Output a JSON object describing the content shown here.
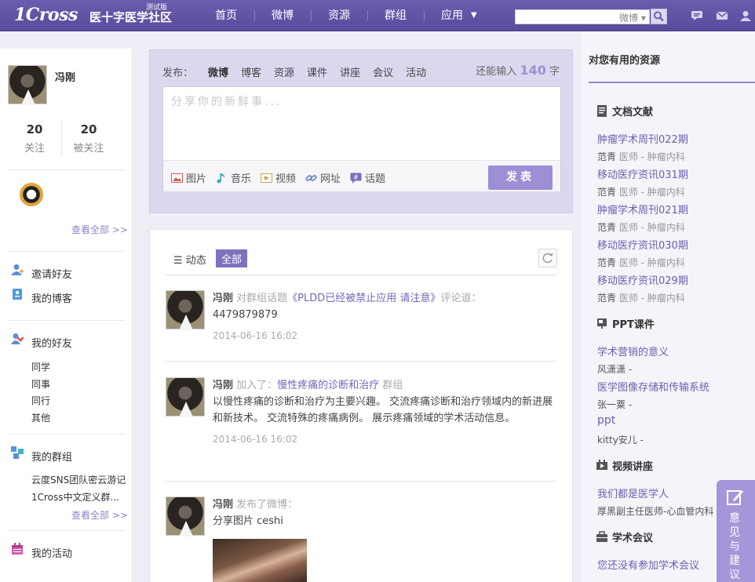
{
  "header": {
    "logo": "1Cross",
    "logo_cn": "医十字医学社区",
    "beta": "测试版",
    "nav": [
      "首页",
      "微博",
      "资源",
      "群组",
      "应用"
    ],
    "search_scope": "微博",
    "search_value": ""
  },
  "profile": {
    "name": "冯刚",
    "following_count": "20",
    "following_label": "关注",
    "followers_count": "20",
    "followers_label": "被关注",
    "view_all": "查看全部 >>"
  },
  "sidebar": {
    "invite": "邀请好友",
    "blog": "我的博客",
    "friends": "我的好友",
    "friend_groups": [
      "同学",
      "同事",
      "同行",
      "其他"
    ],
    "groups": "我的群组",
    "group_items": [
      "云度SNS团队密云游记",
      "1Cross中文定义群..."
    ],
    "groups_view_all": "查看全部 >>",
    "activities": "我的活动"
  },
  "post": {
    "label": "发布：",
    "categories": [
      "微博",
      "博客",
      "资源",
      "课件",
      "讲座",
      "会议",
      "活动"
    ],
    "count_prefix": "还能输入",
    "count": "140",
    "count_suffix": "字",
    "placeholder": "分享你的新鲜事...",
    "tools": [
      "图片",
      "音乐",
      "视频",
      "网址",
      "话题"
    ],
    "submit": "发表"
  },
  "feed": {
    "tab_label": "动态",
    "tab_all": "全部",
    "items": [
      {
        "name": "冯刚",
        "action": "对群组话题",
        "link": "《PLDD已经被禁止应用 请注意》",
        "action2": "评论道：",
        "text": "4479879879",
        "time": "2014-06-16 16:02"
      },
      {
        "name": "冯刚",
        "action": "加入了：",
        "link": "慢性疼痛的诊断和治疗",
        "action2": "群组",
        "text": "以慢性疼痛的诊断和治疗为主要兴趣。 交流疼痛诊断和治疗领域内的新进展和新技术。 交流特殊的疼痛病例。 展示疼痛领域的学术活动信息。",
        "time": "2014-06-16 16:02"
      },
      {
        "name": "冯刚",
        "action": "发布了微博：",
        "link": "",
        "action2": "",
        "text": "分享图片 ceshi",
        "time": ""
      }
    ]
  },
  "resources": {
    "title": "对您有用的资源",
    "doc_title": "文档文献",
    "docs": [
      {
        "title": "肿瘤学术周刊022期",
        "author": "范青",
        "dept": "医师 - 肿瘤内科"
      },
      {
        "title": "移动医疗资讯031期",
        "author": "范青",
        "dept": "医师 - 肿瘤内科"
      },
      {
        "title": "肿瘤学术周刊021期",
        "author": "范青",
        "dept": "医师 - 肿瘤内科"
      },
      {
        "title": "移动医疗资讯030期",
        "author": "范青",
        "dept": "医师 - 肿瘤内科"
      },
      {
        "title": "移动医疗资讯029期",
        "author": "范青",
        "dept": "医师 - 肿瘤内科"
      }
    ],
    "ppt_title": "PPT课件",
    "ppts": [
      {
        "title": "学术营销的意义",
        "author": "风潇潇 -"
      },
      {
        "title": "医学图像存储和传输系统",
        "author": "张一粟 -"
      },
      {
        "title": "ppt",
        "author": "kitty安儿 -"
      }
    ],
    "video_title": "视频讲座",
    "videos": [
      {
        "title": "我们都是医学人",
        "author": "厚黑副主任医师-心血管内科"
      }
    ],
    "meeting_title": "学术会议",
    "meeting_text": "您还没有参加学术会议"
  },
  "feedback": "意见与建议",
  "colors": {
    "header_bg": "#5e4fa2",
    "accent": "#9d8ed6",
    "link": "#6a5fb0"
  }
}
